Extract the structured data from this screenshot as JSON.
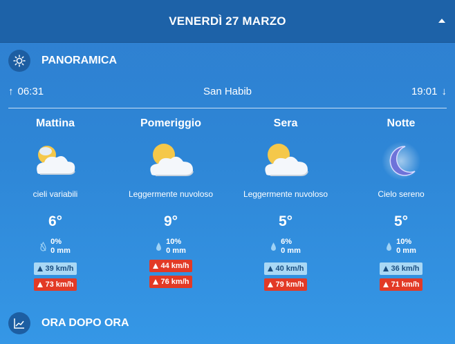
{
  "header": {
    "day_title": "VENERDÌ 27 MARZO"
  },
  "overview": {
    "title": "PANORAMICA",
    "sunrise": "06:31",
    "location": "San Habib",
    "sunset": "19:01"
  },
  "periods": [
    {
      "name": "Mattina",
      "icon": "partly-cloudy-icon",
      "condition": "cieli variabili",
      "temp": "6°",
      "precip_prob": "0%",
      "precip_amount": "0 mm",
      "wind_avg": "39 km/h",
      "wind_gust": "73 km/h",
      "wind_avg_alert": false,
      "wind_gust_alert": true
    },
    {
      "name": "Pomeriggio",
      "icon": "sun-behind-cloud-icon",
      "condition": "Leggermente nuvoloso",
      "temp": "9°",
      "precip_prob": "10%",
      "precip_amount": "0 mm",
      "wind_avg": "44 km/h",
      "wind_gust": "76 km/h",
      "wind_avg_alert": true,
      "wind_gust_alert": true
    },
    {
      "name": "Sera",
      "icon": "sun-behind-cloud-icon",
      "condition": "Leggermente nuvoloso",
      "temp": "5°",
      "precip_prob": "6%",
      "precip_amount": "0 mm",
      "wind_avg": "40 km/h",
      "wind_gust": "79 km/h",
      "wind_avg_alert": false,
      "wind_gust_alert": true
    },
    {
      "name": "Notte",
      "icon": "moon-icon",
      "condition": "Cielo sereno",
      "temp": "5°",
      "precip_prob": "10%",
      "precip_amount": "0 mm",
      "wind_avg": "36 km/h",
      "wind_gust": "71 km/h",
      "wind_avg_alert": false,
      "wind_gust_alert": true
    }
  ],
  "hourly": {
    "title": "ORA DOPO ORA"
  },
  "colors": {
    "header_bg": "#1d62a8",
    "body_bg": "#2f87d6",
    "wind_avg_bg": "#a9d8f5",
    "wind_alert_bg": "#e23a26"
  }
}
